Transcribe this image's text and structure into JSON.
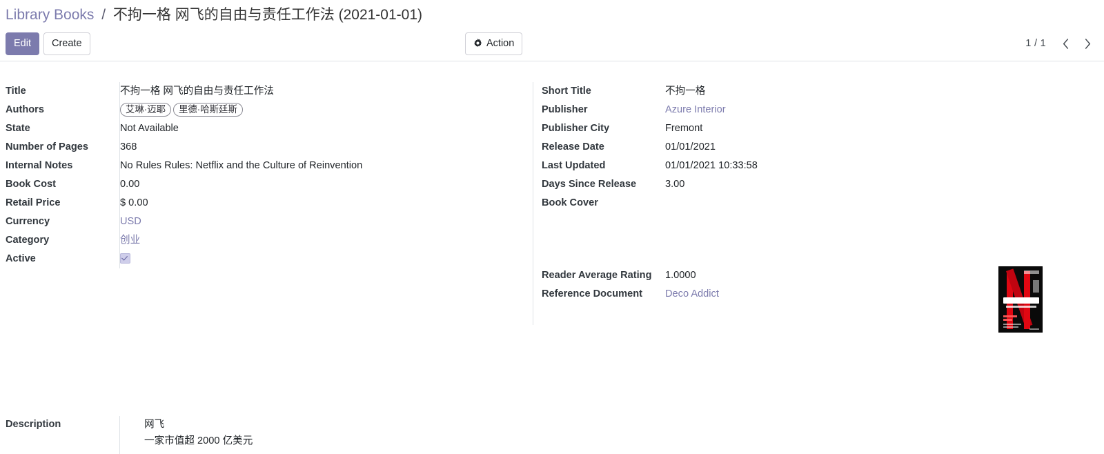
{
  "breadcrumb": {
    "root": "Library Books",
    "separator": "/",
    "current": "不拘一格 网飞的自由与责任工作法 (2021-01-01)"
  },
  "toolbar": {
    "edit_label": "Edit",
    "create_label": "Create",
    "action_label": "Action",
    "action_icon": "gear-icon",
    "gear_glyph": "✿"
  },
  "pager": {
    "count": "1 / 1",
    "previous_icon": "chevron-left-icon",
    "next_icon": "chevron-right-icon"
  },
  "left_fields": [
    {
      "label": "Title",
      "value": "不拘一格 网飞的自由与责任工作法",
      "kind": "text"
    },
    {
      "label": "Authors",
      "value": "",
      "kind": "tags",
      "tags": [
        "艾琳·迈耶",
        "里德·哈斯廷斯"
      ]
    },
    {
      "label": "State",
      "value": "Not Available",
      "kind": "text"
    },
    {
      "label": "Number of Pages",
      "value": "368",
      "kind": "text"
    },
    {
      "label": "Internal Notes",
      "value": "No Rules Rules: Netflix and the Culture of Reinvention",
      "kind": "text"
    },
    {
      "label": "Book Cost",
      "value": "0.00",
      "kind": "text"
    },
    {
      "label": "Retail Price",
      "value": "$ 0.00",
      "kind": "text"
    },
    {
      "label": "Currency",
      "value": "USD",
      "kind": "link"
    },
    {
      "label": "Category",
      "value": "创业",
      "kind": "link"
    },
    {
      "label": "Active",
      "value": "",
      "kind": "checkbox",
      "checked": true
    }
  ],
  "right_fields": [
    {
      "label": "Short Title",
      "value": "不拘一格",
      "kind": "text"
    },
    {
      "label": "Publisher",
      "value": "Azure Interior",
      "kind": "link"
    },
    {
      "label": "Publisher City",
      "value": "Fremont",
      "kind": "text"
    },
    {
      "label": "Release Date",
      "value": "01/01/2021",
      "kind": "text"
    },
    {
      "label": "Last Updated",
      "value": "01/01/2021 10:33:58",
      "kind": "text"
    },
    {
      "label": "Days Since Release",
      "value": "3.00",
      "kind": "text"
    },
    {
      "label": "Book Cover",
      "value": "",
      "kind": "image"
    }
  ],
  "right_fields_lower": [
    {
      "label": "Reader Average Rating",
      "value": "1.0000",
      "kind": "text"
    },
    {
      "label": "Reference Document",
      "value": "Deco Addict",
      "kind": "link"
    }
  ],
  "book_cover": {
    "alt": "book-cover-image",
    "title_cn": "不拘一格",
    "subtitle_cn": "网飞的自由与责任工作法",
    "title_en": "No Rules Rules"
  },
  "description": {
    "label": "Description",
    "line1": "网飞",
    "line2": "一家市值超 2000 亿美元"
  },
  "colors": {
    "brand_purple": "#7C7BAD",
    "border": "#dee2e6",
    "text": "#212529",
    "cover_red": "#e00712"
  }
}
